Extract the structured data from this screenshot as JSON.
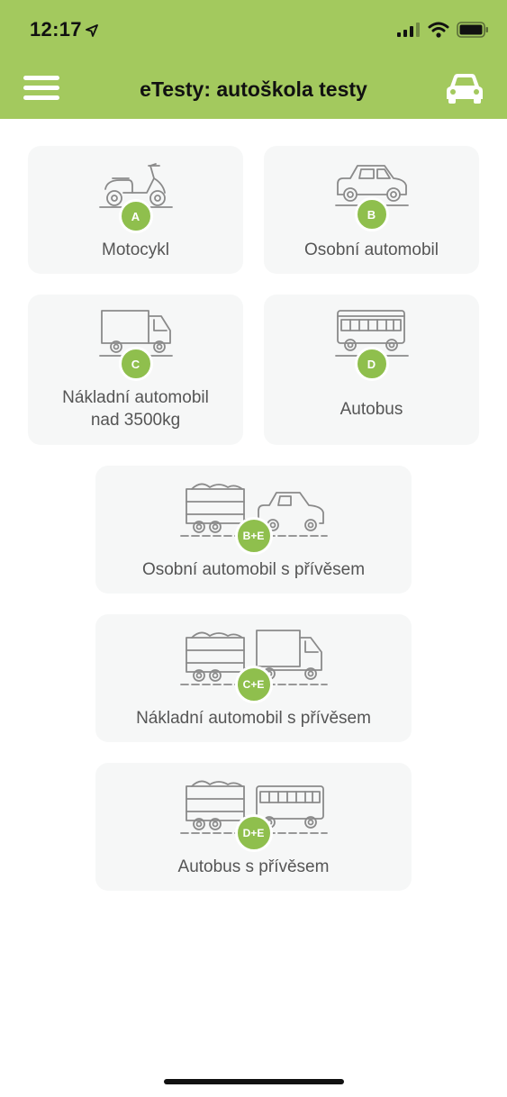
{
  "status_bar": {
    "time": "12:17"
  },
  "header": {
    "title": "eTesty: autoškola testy"
  },
  "categories": [
    {
      "badge": "A",
      "label": "Motocykl",
      "icon": "motorcycle-icon"
    },
    {
      "badge": "B",
      "label": "Osobní automobil",
      "icon": "car-icon"
    },
    {
      "badge": "C",
      "label_line1": "Nákladní automobil",
      "label_line2": "nad 3500kg",
      "icon": "truck-icon"
    },
    {
      "badge": "D",
      "label": "Autobus",
      "icon": "bus-icon"
    },
    {
      "badge": "B+E",
      "label": "Osobní automobil s přívěsem",
      "icon": "car-trailer-icon"
    },
    {
      "badge": "C+E",
      "label": "Nákladní automobil s přívěsem",
      "icon": "truck-trailer-icon"
    },
    {
      "badge": "D+E",
      "label": "Autobus s přívěsem",
      "icon": "bus-trailer-icon"
    }
  ],
  "colors": {
    "header_bg": "#a3c95e",
    "badge_bg": "#8fbf4d",
    "card_bg": "#f6f7f7",
    "icon_stroke": "#8a8a8a"
  }
}
